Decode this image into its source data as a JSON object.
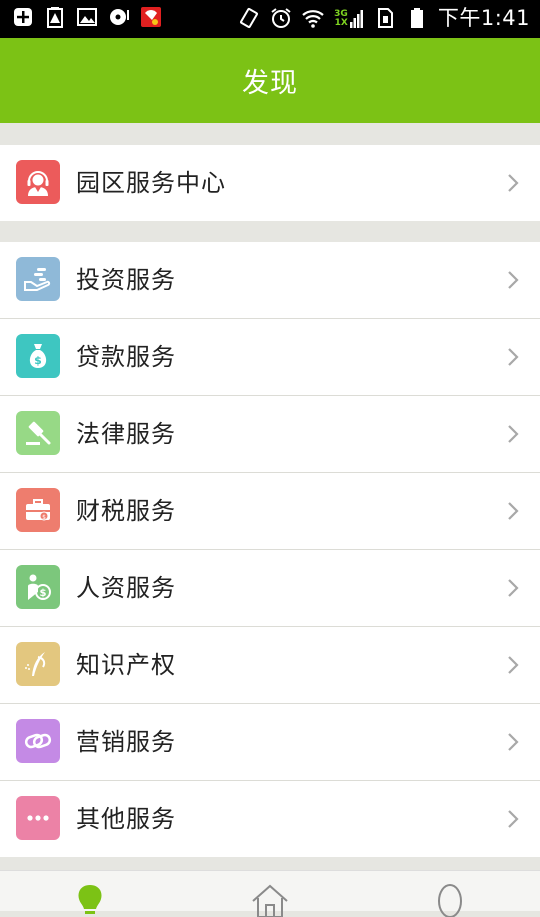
{
  "status_bar": {
    "time": "下午1:41",
    "network": "3G\n1X"
  },
  "header": {
    "title": "发现"
  },
  "service_center": {
    "label": "园区服务中心",
    "icon": "customer-service-icon",
    "color": "#ec5b5b"
  },
  "services": [
    {
      "label": "投资服务",
      "icon": "investment-hand-icon",
      "color": "#8fb9d8"
    },
    {
      "label": "贷款服务",
      "icon": "money-bag-icon",
      "color": "#3ec6c1"
    },
    {
      "label": "法律服务",
      "icon": "gavel-icon",
      "color": "#97d986"
    },
    {
      "label": "财税服务",
      "icon": "briefcase-icon",
      "color": "#ee7d6e"
    },
    {
      "label": "人资服务",
      "icon": "person-coin-icon",
      "color": "#7cc77c"
    },
    {
      "label": "知识产权",
      "icon": "quill-icon",
      "color": "#e3c77f"
    },
    {
      "label": "营销服务",
      "icon": "link-loop-icon",
      "color": "#c48ae5"
    },
    {
      "label": "其他服务",
      "icon": "more-dots-icon",
      "color": "#ec82a6"
    }
  ],
  "tabs": [
    {
      "name": "discover",
      "icon": "lightbulb-icon",
      "active": true,
      "color": "#7cc215"
    },
    {
      "name": "home",
      "icon": "home-icon",
      "active": false,
      "color": "#8a8a8a"
    },
    {
      "name": "profile",
      "icon": "profile-icon",
      "active": false,
      "color": "#8a8a8a"
    }
  ]
}
